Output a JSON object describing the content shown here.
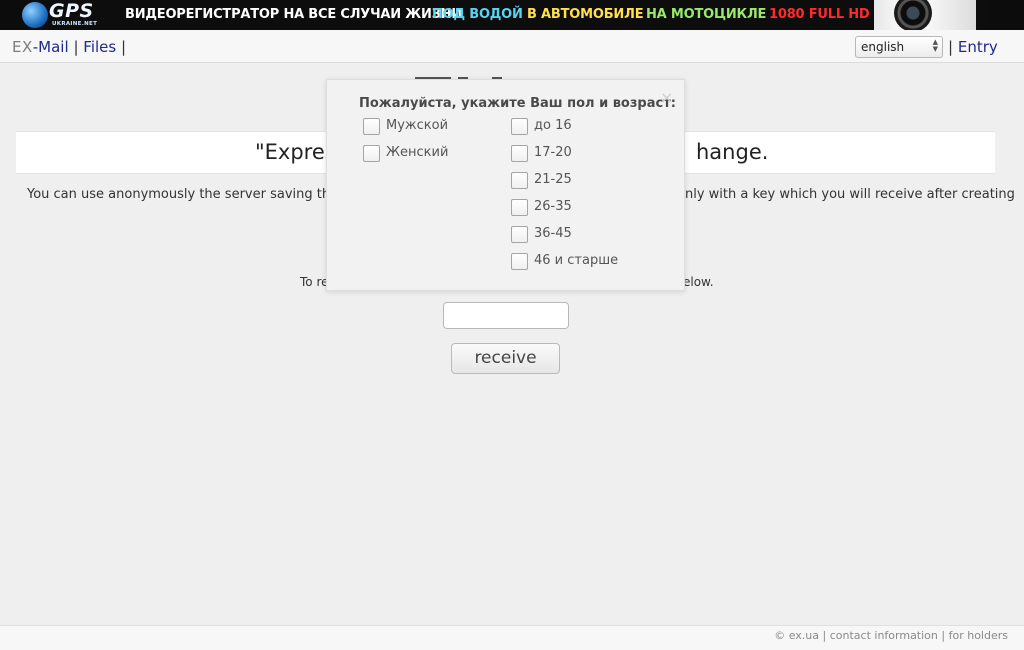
{
  "banner": {
    "logo_text": "GPS",
    "logo_sub": "UKRAINE.NET",
    "headline": "ВИДЕОРЕГИСТРАТОР НА ВСЕ СЛУЧАИ ЖИЗНИ",
    "tag_water": "ПОД ВОДОЙ",
    "tag_car": "В АВТОМОБИЛЕ",
    "tag_moto": "НА МОТОЦИКЛЕ",
    "tag_hd": "1080 FULL HD",
    "colors": {
      "water": "#58d3f0",
      "car": "#ffe04a",
      "moto": "#9be86a",
      "hd": "#ff2a2a"
    }
  },
  "nav": {
    "logo": "EX",
    "mail": "-Mail",
    "sep1": "|",
    "files": "Files",
    "sep2": "|",
    "language": "english",
    "sep3": "|",
    "entry": "Entry"
  },
  "main": {
    "title_left": "\"Expres",
    "title_right": "hange.",
    "desc_left": "You can use anonymously the server saving the fi",
    "desc_right": "nly with a key which you will receive after creating",
    "receive_left": "To re",
    "receive_right": "elow.",
    "key_input_value": "",
    "receive_button": "receive"
  },
  "popup": {
    "title": "Пожалуйста, укажите Ваш пол и возраст:",
    "close": "×",
    "gender": [
      "Мужской",
      "Женский"
    ],
    "age": [
      "до 16",
      "17-20",
      "21-25",
      "26-35",
      "36-45",
      "46 и старше"
    ]
  },
  "footer": {
    "copyright": "© ex.ua",
    "sep1": "|",
    "contact": "contact information",
    "sep2": "|",
    "holders": "for holders"
  }
}
